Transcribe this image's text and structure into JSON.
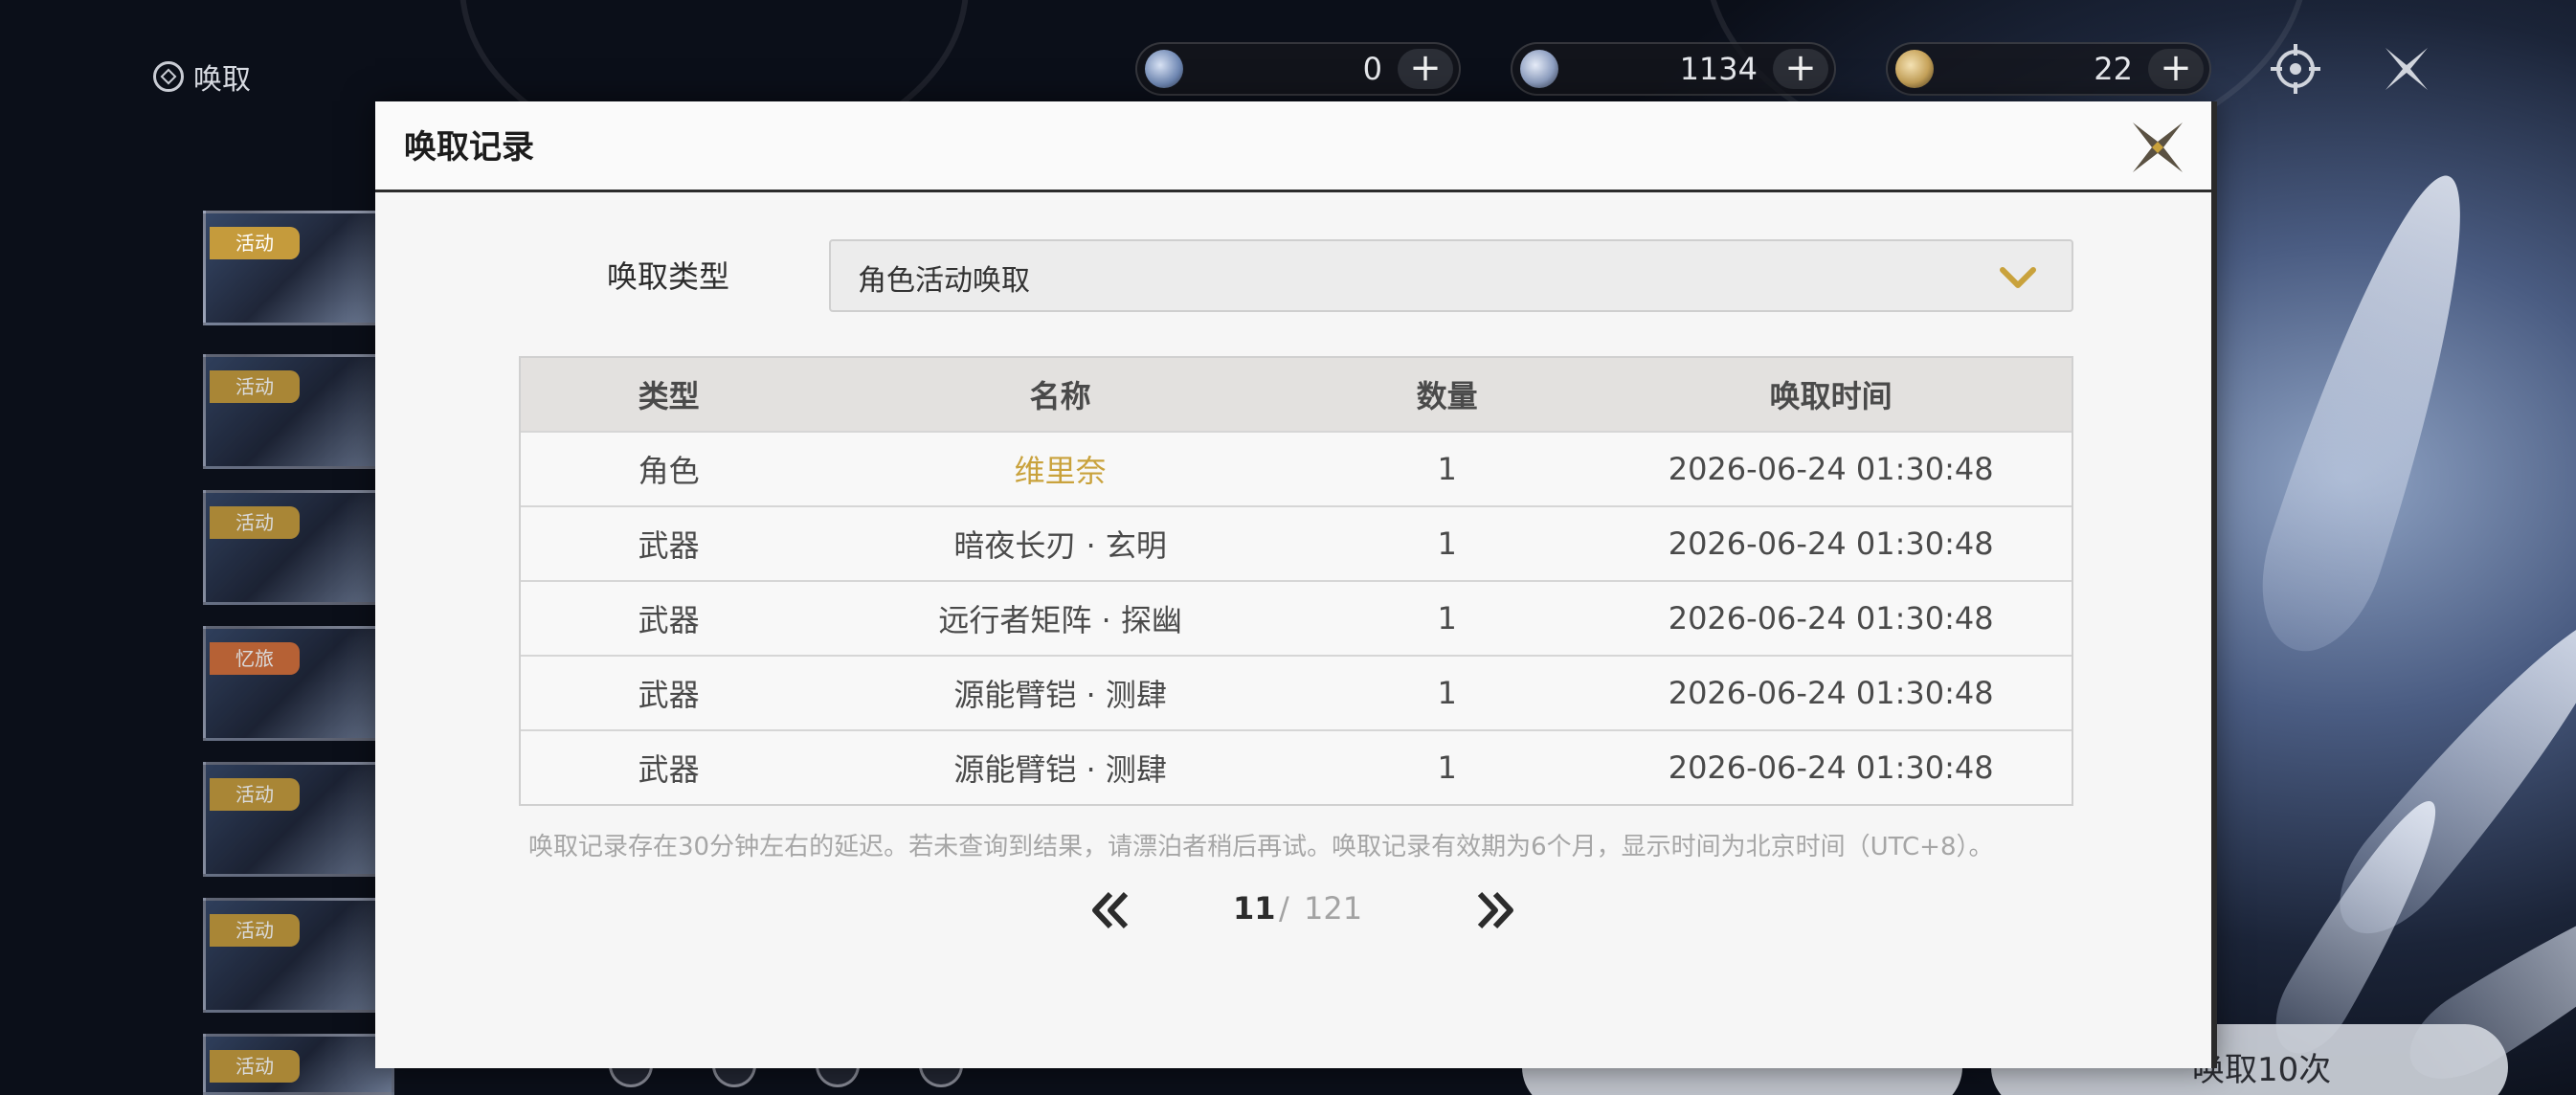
{
  "top_bar": {
    "title": "唤取",
    "currencies": [
      {
        "name": "lunite",
        "value": "0",
        "color": "#6f88b4"
      },
      {
        "name": "star-crystal",
        "value": "1134",
        "color": "#8fa0c2"
      },
      {
        "name": "gold-tide",
        "value": "22",
        "color": "#c7a35a"
      }
    ],
    "plus_label": "+"
  },
  "banners": [
    {
      "tag": "活动",
      "tag_color": "#c59b3c"
    },
    {
      "tag": "活动",
      "tag_color": "#c59b3c"
    },
    {
      "tag": "活动",
      "tag_color": "#c59b3c"
    },
    {
      "tag": "忆旅",
      "tag_color": "#d4703a"
    },
    {
      "tag": "活动",
      "tag_color": "#c59b3c"
    },
    {
      "tag": "活动",
      "tag_color": "#c59b3c"
    },
    {
      "tag": "活动",
      "tag_color": "#c59b3c"
    }
  ],
  "bottom": {
    "pull10_label": "唤取10次"
  },
  "modal": {
    "title": "唤取记录",
    "type_label": "唤取类型",
    "type_selected": "角色活动唤取",
    "columns": [
      "类型",
      "名称",
      "数量",
      "唤取时间"
    ],
    "rows": [
      {
        "type": "角色",
        "name": "维里奈",
        "qty": "1",
        "time": "2026-06-24 01:30:48",
        "highlight": true
      },
      {
        "type": "武器",
        "name": "暗夜长刃 · 玄明",
        "qty": "1",
        "time": "2026-06-24 01:30:48",
        "highlight": false
      },
      {
        "type": "武器",
        "name": "远行者矩阵 · 探幽",
        "qty": "1",
        "time": "2026-06-24 01:30:48",
        "highlight": false
      },
      {
        "type": "武器",
        "name": "源能臂铠 · 测肆",
        "qty": "1",
        "time": "2026-06-24 01:30:48",
        "highlight": false
      },
      {
        "type": "武器",
        "name": "源能臂铠 · 测肆",
        "qty": "1",
        "time": "2026-06-24 01:30:48",
        "highlight": false
      }
    ],
    "note": "唤取记录存在30分钟左右的延迟。若未查询到结果，请漂泊者稍后再试。唤取记录有效期为6个月，显示时间为北京时间（UTC+8）。",
    "pager": {
      "current": "11",
      "separator": "/",
      "total": "121"
    },
    "highlight_color": "#c9a23c"
  }
}
